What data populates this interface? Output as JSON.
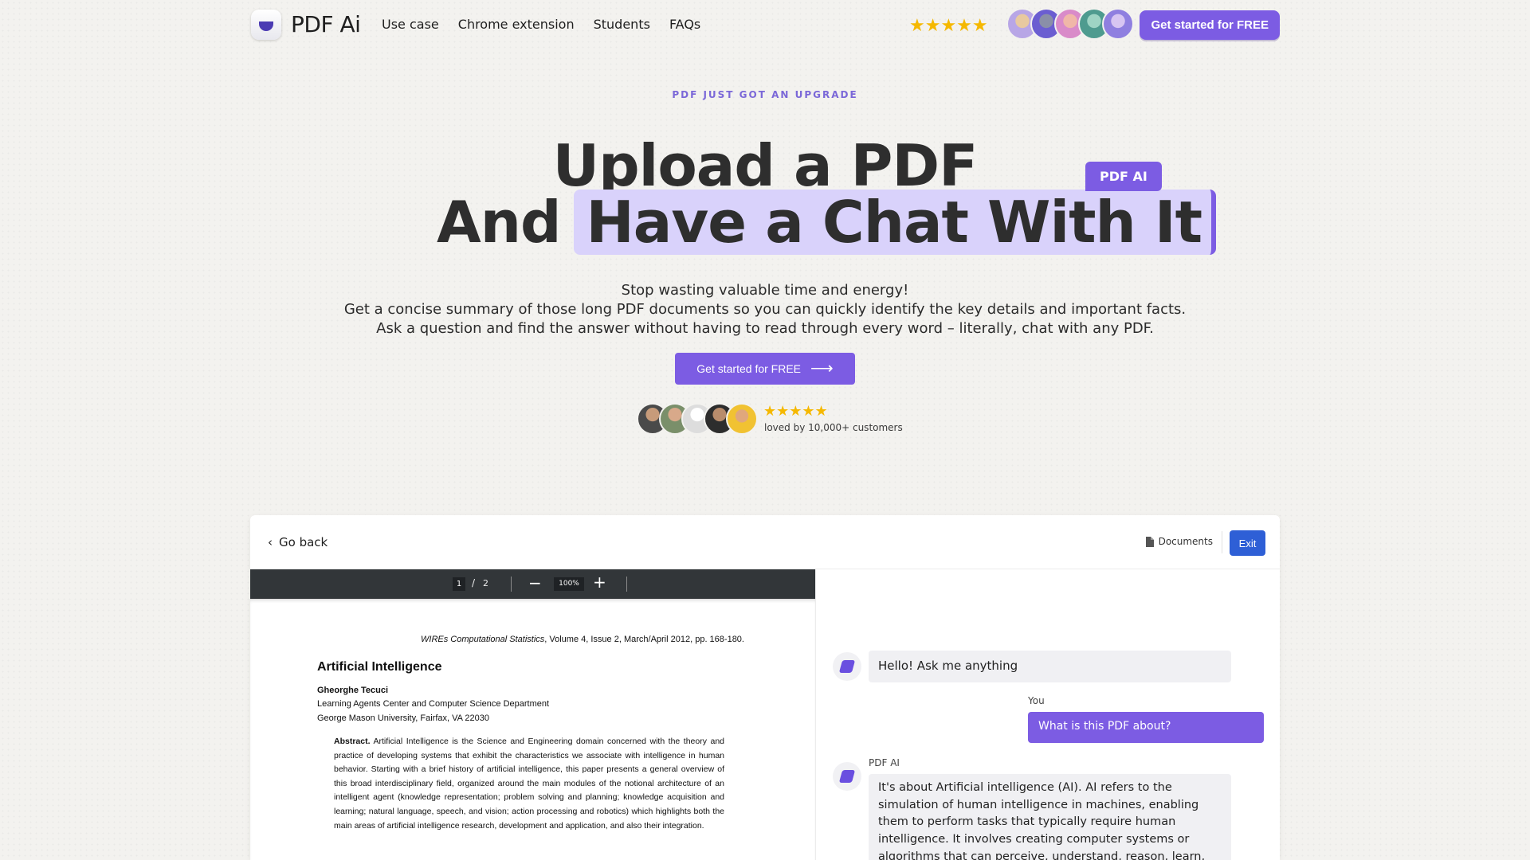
{
  "nav": {
    "logo_text": "PDF Ai",
    "links": [
      "Use case",
      "Chrome extension",
      "Students",
      "FAQs"
    ],
    "stars": "★★★★★",
    "cta": "Get started for FREE"
  },
  "hero": {
    "eyebrow": "PDF JUST GOT AN UPGRADE",
    "title_line1": "Upload a PDF",
    "title_line2_plain": "And",
    "title_line2_highlight": "Have a Chat With It",
    "tag": "PDF AI",
    "sub1": "Stop wasting valuable time and energy!",
    "sub2": "Get a concise summary of those long PDF documents so you can quickly identify the key details and important facts.",
    "sub3": "Ask a question and find the answer without having to read through every word – literally, chat with any PDF.",
    "cta": "Get started for FREE",
    "stars": "★★★★★",
    "loved": "loved by 10,000+ customers"
  },
  "demo": {
    "go_back": "Go back",
    "documents": "Documents",
    "exit": "Exit",
    "viewer": {
      "page_current": "1",
      "page_sep": "/",
      "page_total": "2",
      "zoom": "100%"
    },
    "pdf": {
      "journal_italic": "WIREs Computational Statistics",
      "journal_rest": ", Volume 4, Issue 2, March/April 2012, pp. 168-180.",
      "title": "Artificial Intelligence",
      "author": "Gheorghe Tecuci",
      "affil1": "Learning Agents Center and Computer Science Department",
      "affil2": "George Mason University, Fairfax, VA 22030",
      "abstract_label": "Abstract.",
      "abstract_text": " Artificial Intelligence is the Science and Engineering domain concerned with the theory and practice of developing systems that exhibit the characteristics we associate with intelligence in human behavior. Starting with a brief history of artificial intelligence, this paper presents a general overview of this broad interdisciplinary field, organized around the main modules of the notional architecture of an intelligent agent (knowledge representation; problem solving and planning; knowledge acquisition and learning; natural language, speech, and vision; action processing and robotics) which highlights both the main areas of artificial intelligence research, development and application, and also their integration."
    },
    "chat": {
      "greeting": "Hello! Ask me anything",
      "you_label": "You",
      "user_msg": "What is this PDF about?",
      "bot_label": "PDF AI",
      "bot_reply": "It's about Artificial intelligence (AI). AI refers to the simulation of human intelligence in machines, enabling them to perform tasks that typically require human intelligence. It involves creating computer systems or algorithms that can perceive, understand, reason, learn, and make decisions in a way that"
    }
  },
  "colors": {
    "accent": "#7c5ce3",
    "highlight": "#d9d2fb",
    "exit_blue": "#2e5fd6",
    "star": "#f5b800"
  }
}
